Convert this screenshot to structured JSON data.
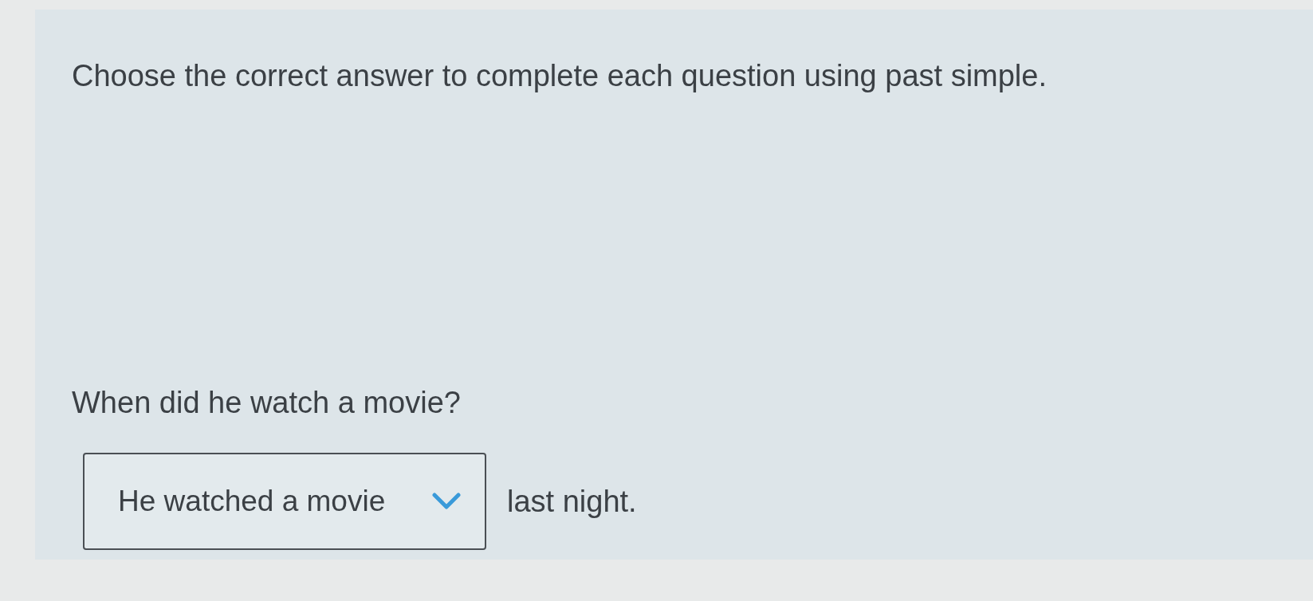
{
  "instruction": "Choose the correct answer to complete each question using past simple.",
  "question": {
    "prompt": "When did he watch a movie?",
    "answer_select": {
      "value": "He watched a movie"
    },
    "after_text": "last night."
  }
}
